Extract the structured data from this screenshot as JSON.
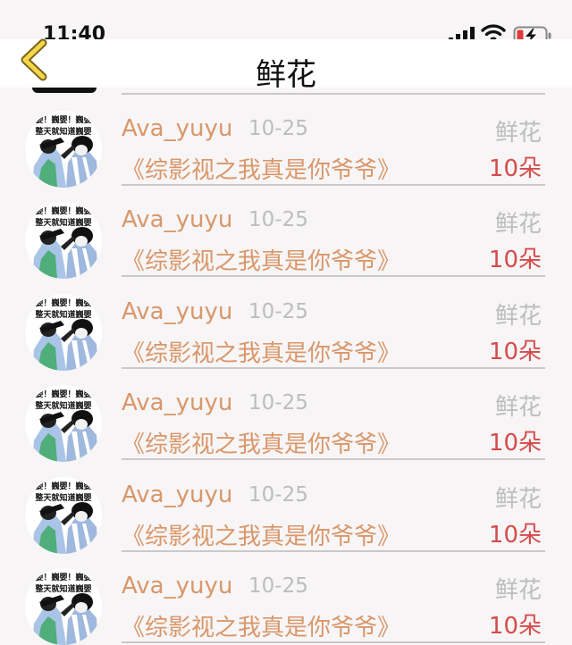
{
  "status_bar": {
    "time": "11:40"
  },
  "nav": {
    "title": "鲜花"
  },
  "avatar": {
    "line1": "巍婴！巍婴！巍婴！",
    "line2": "整天就知道巍婴"
  },
  "rows": [
    {
      "username": "Ava_yuyu",
      "date": "10-25",
      "gift_type": "鲜花",
      "book": "《综影视之我真是你爷爷》",
      "count": "10朵"
    },
    {
      "username": "Ava_yuyu",
      "date": "10-25",
      "gift_type": "鲜花",
      "book": "《综影视之我真是你爷爷》",
      "count": "10朵"
    },
    {
      "username": "Ava_yuyu",
      "date": "10-25",
      "gift_type": "鲜花",
      "book": "《综影视之我真是你爷爷》",
      "count": "10朵"
    },
    {
      "username": "Ava_yuyu",
      "date": "10-25",
      "gift_type": "鲜花",
      "book": "《综影视之我真是你爷爷》",
      "count": "10朵"
    },
    {
      "username": "Ava_yuyu",
      "date": "10-25",
      "gift_type": "鲜花",
      "book": "《综影视之我真是你爷爷》",
      "count": "10朵"
    },
    {
      "username": "Ava_yuyu",
      "date": "10-25",
      "gift_type": "鲜花",
      "book": "《综影视之我真是你爷爷》",
      "count": "10朵"
    }
  ]
}
